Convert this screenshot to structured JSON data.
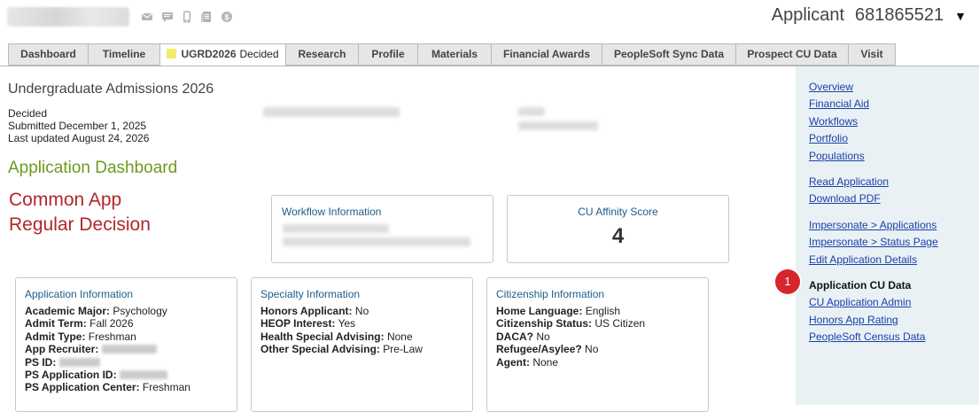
{
  "header": {
    "role": "Applicant",
    "applicant_id": "681865521",
    "menu_caret": "▼",
    "icons": [
      "mail-icon",
      "chat-icon",
      "phone-icon",
      "document-icon",
      "money-icon"
    ]
  },
  "tabs": [
    {
      "label": "Dashboard",
      "active": false
    },
    {
      "label": "Timeline",
      "active": false
    },
    {
      "label": "UGRD2026",
      "sub": "Decided",
      "active": true
    },
    {
      "label": "Research",
      "active": false
    },
    {
      "label": "Profile",
      "active": false
    },
    {
      "label": "Materials",
      "active": false
    },
    {
      "label": "Financial Awards",
      "active": false
    },
    {
      "label": "PeopleSoft Sync Data",
      "active": false
    },
    {
      "label": "Prospect CU Data",
      "active": false
    },
    {
      "label": "Visit",
      "active": false
    }
  ],
  "application": {
    "title": "Undergraduate Admissions 2026",
    "status": "Decided",
    "submitted": "Submitted December 1, 2025",
    "updated": "Last updated August 24, 2026",
    "dashboard_heading": "Application Dashboard",
    "round_line1": "Common App",
    "round_line2": "Regular Decision"
  },
  "workflow": {
    "heading": "Workflow Information"
  },
  "affinity": {
    "heading": "CU Affinity Score",
    "value": "4"
  },
  "app_info": {
    "heading": "Application Information",
    "rows": [
      {
        "label": "Academic Major:",
        "value": "Psychology"
      },
      {
        "label": "Admit Term:",
        "value": "Fall 2026"
      },
      {
        "label": "Admit Type:",
        "value": "Freshman"
      },
      {
        "label": "App Recruiter:",
        "value": ""
      },
      {
        "label": "PS ID:",
        "value": ""
      },
      {
        "label": "PS Application ID:",
        "value": ""
      },
      {
        "label": "PS Application Center:",
        "value": "Freshman"
      }
    ]
  },
  "specialty": {
    "heading": "Specialty Information",
    "rows": [
      {
        "label": "Honors Applicant:",
        "value": "No"
      },
      {
        "label": "HEOP Interest:",
        "value": "Yes"
      },
      {
        "label": "Health Special Advising:",
        "value": "None"
      },
      {
        "label": "Other Special Advising:",
        "value": "Pre-Law"
      }
    ]
  },
  "citizenship": {
    "heading": "Citizenship Information",
    "rows": [
      {
        "label": "Home Language:",
        "value": "English"
      },
      {
        "label": "Citizenship Status:",
        "value": "US Citizen"
      },
      {
        "label": "DACA?",
        "value": "No"
      },
      {
        "label": "Refugee/Asylee?",
        "value": "No"
      },
      {
        "label": "Agent:",
        "value": "None"
      }
    ]
  },
  "sidebar": {
    "group1": [
      "Overview",
      "Financial Aid",
      "Workflows",
      "Portfolio",
      "Populations"
    ],
    "group2": [
      "Read Application",
      "Download PDF"
    ],
    "group3": [
      "Impersonate > Applications",
      "Impersonate > Status Page",
      "Edit Application Details"
    ],
    "current": "Application CU Data",
    "group4": [
      "CU Application Admin",
      "Honors App Rating",
      "PeopleSoft Census Data"
    ],
    "badge": "1"
  }
}
